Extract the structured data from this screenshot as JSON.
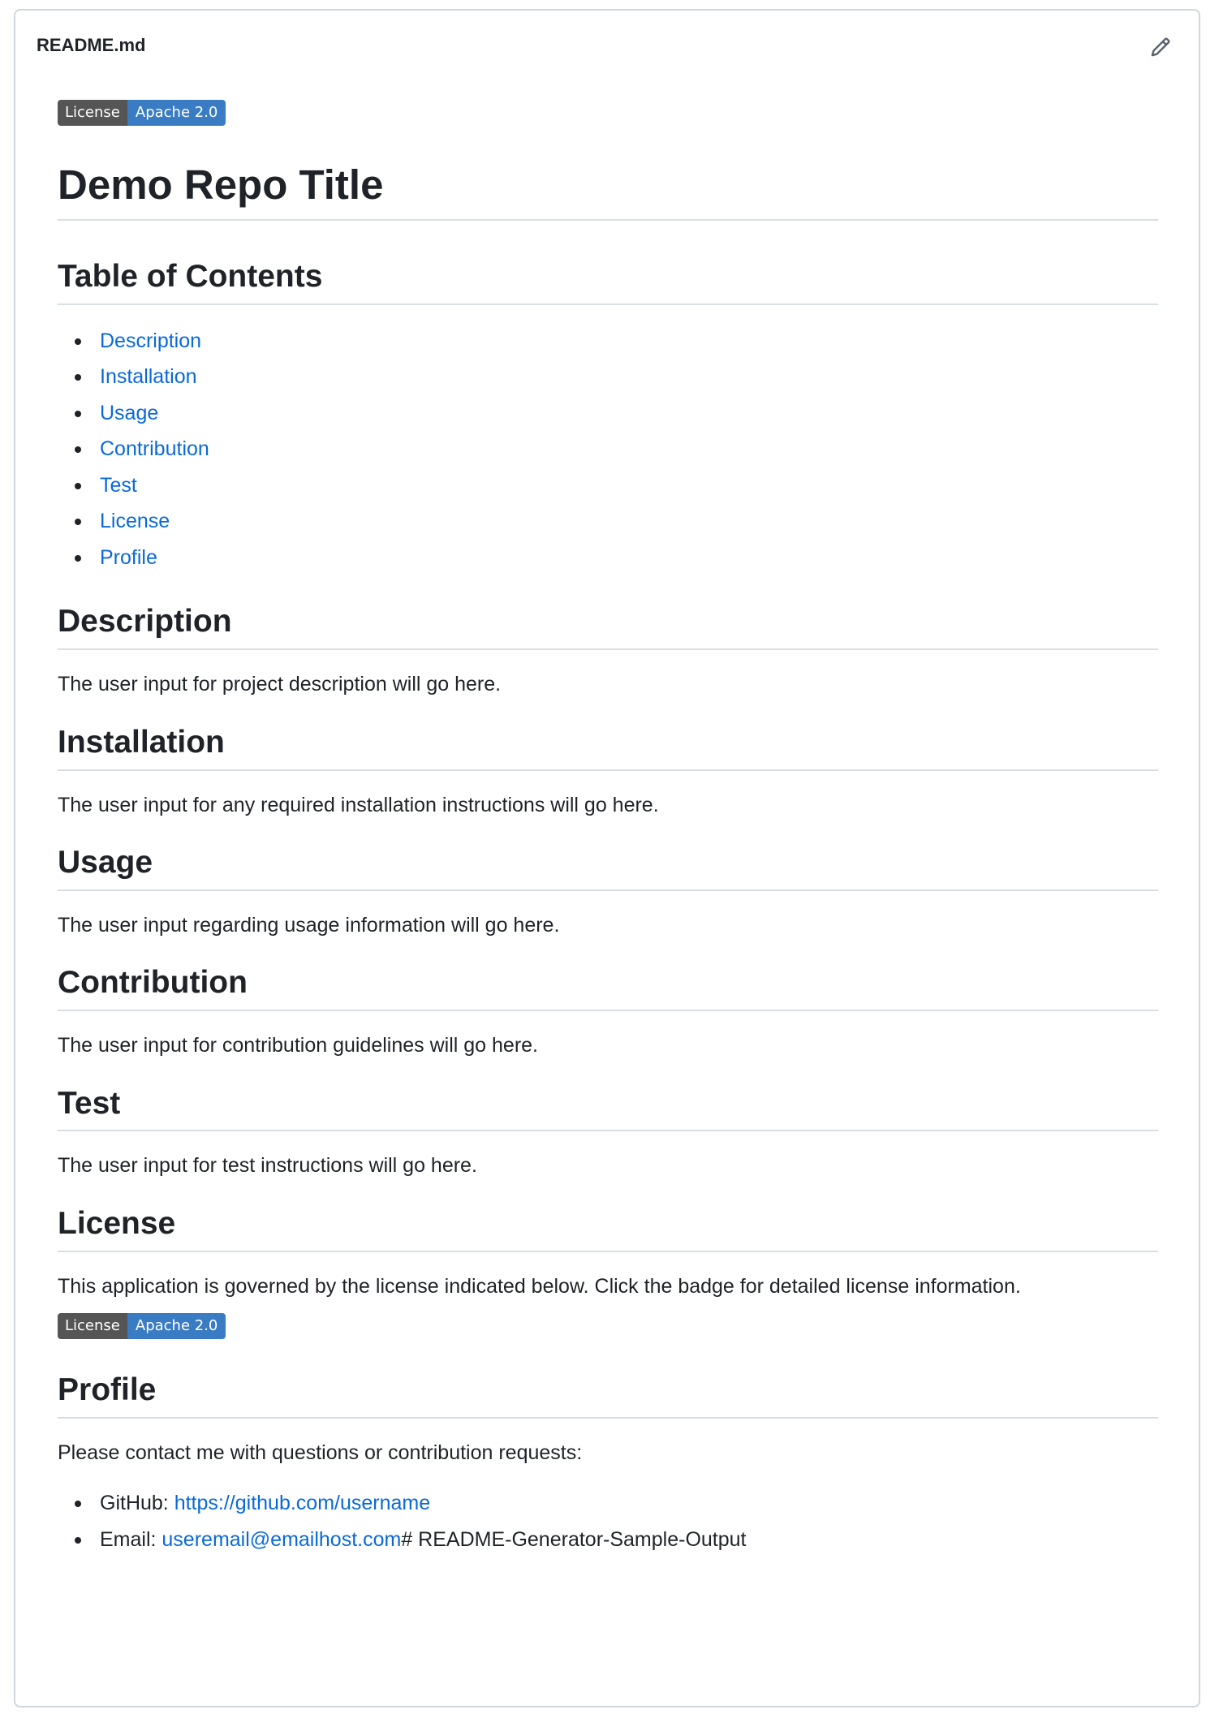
{
  "header": {
    "file_name": "README.md",
    "edit_icon": "pencil-icon"
  },
  "badge": {
    "left": "License",
    "right": "Apache 2.0",
    "left_color": "#555555",
    "right_color": "#3a7cc4"
  },
  "title": "Demo Repo Title",
  "toc": {
    "heading": "Table of Contents",
    "items": [
      "Description",
      "Installation",
      "Usage",
      "Contribution",
      "Test",
      "License",
      "Profile"
    ]
  },
  "sections": {
    "description": {
      "heading": "Description",
      "text": "The user input for project description will go here."
    },
    "installation": {
      "heading": "Installation",
      "text": "The user input for any required installation instructions will go here."
    },
    "usage": {
      "heading": "Usage",
      "text": "The user input regarding usage information will go here."
    },
    "contribution": {
      "heading": "Contribution",
      "text": "The user input for contribution guidelines will go here."
    },
    "test": {
      "heading": "Test",
      "text": "The user input for test instructions will go here."
    },
    "license": {
      "heading": "License",
      "text": "This application is governed by the license indicated below. Click the badge for detailed license information."
    },
    "profile": {
      "heading": "Profile",
      "text": "Please contact me with questions or contribution requests:",
      "github_label": "GitHub: ",
      "github_link": "https://github.com/username",
      "email_label": "Email: ",
      "email_link": "useremail@emailhost.com",
      "email_trailing": "# README-Generator-Sample-Output"
    }
  },
  "colors": {
    "link": "#0969da",
    "text": "#1f2328",
    "border": "#d0d7de"
  }
}
